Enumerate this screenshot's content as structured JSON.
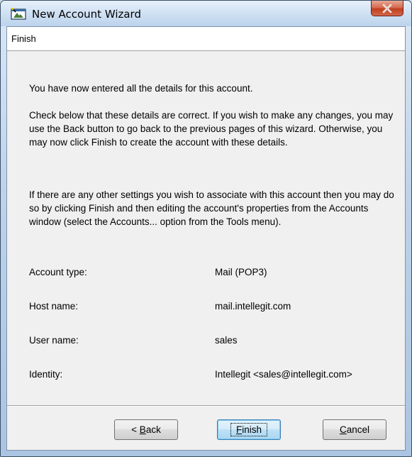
{
  "window": {
    "title": "New Account Wizard"
  },
  "header": {
    "page_title": "Finish"
  },
  "body": {
    "intro": "You have now entered all the details for this account.",
    "check": "Check below that these details are correct.  If you wish to make any changes, you may use the Back button to go back to the previous pages of this wizard.  Otherwise, you may now click Finish to create the account with these details.",
    "other": "If there are any other settings you wish to associate with this account then you may do so by clicking Finish and then editing the account's properties from the Accounts window (select the Accounts... option from the Tools menu)."
  },
  "details": [
    {
      "label": "Account type:",
      "value": "Mail (POP3)"
    },
    {
      "label": "Host name:",
      "value": "mail.intellegit.com"
    },
    {
      "label": "User name:",
      "value": "sales"
    },
    {
      "label": "Identity:",
      "value": "Intellegit <sales@intellegit.com>"
    }
  ],
  "buttons": {
    "back_prefix": "< ",
    "back_accel": "B",
    "back_rest": "ack",
    "finish_accel": "F",
    "finish_rest": "inish",
    "cancel_accel": "C",
    "cancel_rest": "ancel"
  },
  "colors": {
    "close_button": "#c0401f",
    "default_button_border": "#3c7fb1"
  },
  "icons": {
    "app": "wizard-icon",
    "close": "close-icon"
  }
}
